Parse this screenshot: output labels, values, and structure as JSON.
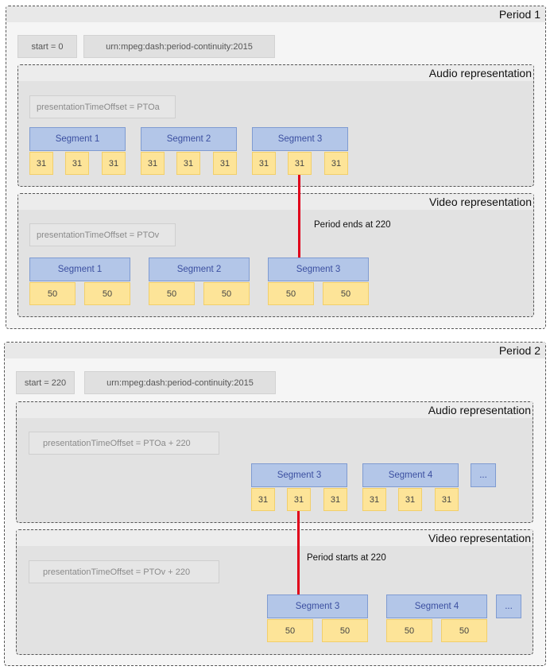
{
  "period1": {
    "title": "Period 1",
    "start": "start = 0",
    "continuity": "urn:mpeg:dash:period-continuity:2015",
    "audio": {
      "title": "Audio representation",
      "pto": "presentationTimeOffset = PTOa",
      "segments": [
        "Segment 1",
        "Segment 2",
        "Segment 3"
      ],
      "cell": "31"
    },
    "video": {
      "title": "Video representation",
      "pto": "presentationTimeOffset = PTOv",
      "segments": [
        "Segment 1",
        "Segment 2",
        "Segment 3"
      ],
      "cell": "50"
    },
    "note": "Period ends at 220"
  },
  "period2": {
    "title": "Period 2",
    "start": "start = 220",
    "continuity": "urn:mpeg:dash:period-continuity:2015",
    "audio": {
      "title": "Audio representation",
      "pto": "presentationTimeOffset = PTOa + 220",
      "segments": [
        "Segment 3",
        "Segment 4"
      ],
      "ellipsis": "...",
      "cell": "31"
    },
    "video": {
      "title": "Video representation",
      "pto": "presentationTimeOffset = PTOv + 220",
      "segments": [
        "Segment 3",
        "Segment 4"
      ],
      "ellipsis": "...",
      "cell": "50"
    },
    "note": "Period starts at 220"
  },
  "colors": {
    "segment_fill": "#b3c6e8",
    "sample_fill": "#fde498",
    "boundary_line": "#e0001a"
  }
}
